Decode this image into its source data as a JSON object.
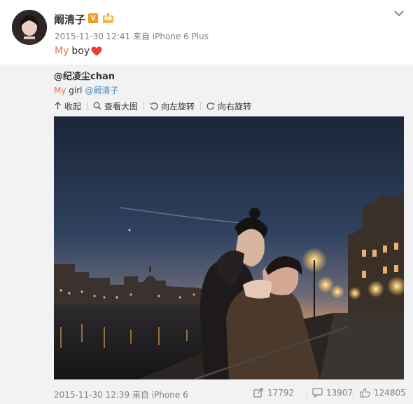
{
  "post": {
    "author": "阚清子",
    "meta": "2015-11-30 12:41 来自 iPhone 6 Plus",
    "text_my": "My",
    "text_boy": "boy"
  },
  "repost": {
    "author": "@纪凌尘chan",
    "text_my": "My",
    "text_girl": "girl",
    "mention": "@阚清子",
    "tools": {
      "collapse": "收起",
      "view_large": "查看大图",
      "rotate_left": "向左旋转",
      "rotate_right": "向右旋转"
    },
    "footer": {
      "time": "2015-11-30 12:39 来自 iPhone 6",
      "reposts": "17792",
      "comments": "13907",
      "likes": "124805"
    }
  },
  "colors": {
    "accent_orange": "#eb7350",
    "link_blue": "#4a8bc7",
    "heart_red": "#e8412f",
    "v_badge": "#f39a1c"
  },
  "icons": [
    "collapse-icon",
    "search-icon",
    "rotate-left-icon",
    "rotate-right-icon",
    "repost-icon",
    "comment-icon",
    "like-icon",
    "chevron-down-icon",
    "heart-icon"
  ]
}
